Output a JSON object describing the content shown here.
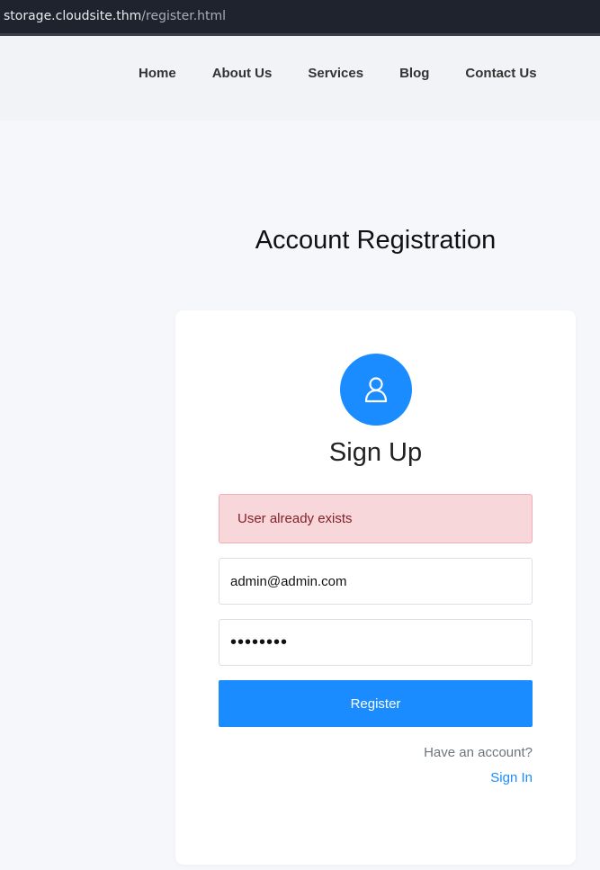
{
  "browser": {
    "url_host": "storage.cloudsite.thm",
    "url_path": "/register.html"
  },
  "nav": {
    "items": [
      "Home",
      "About Us",
      "Services",
      "Blog",
      "Contact Us"
    ]
  },
  "page": {
    "title": "Account Registration"
  },
  "signup": {
    "avatar_icon": "user-icon",
    "title": "Sign Up",
    "alert_message": "User already exists",
    "email_value": "admin@admin.com",
    "password_value": "password",
    "register_label": "Register",
    "have_account_text": "Have an account?",
    "signin_label": "Sign In"
  },
  "colors": {
    "accent": "#1a8cff",
    "alert_bg": "#f8d7da",
    "alert_text": "#842029",
    "page_bg": "#f6f7fb"
  }
}
